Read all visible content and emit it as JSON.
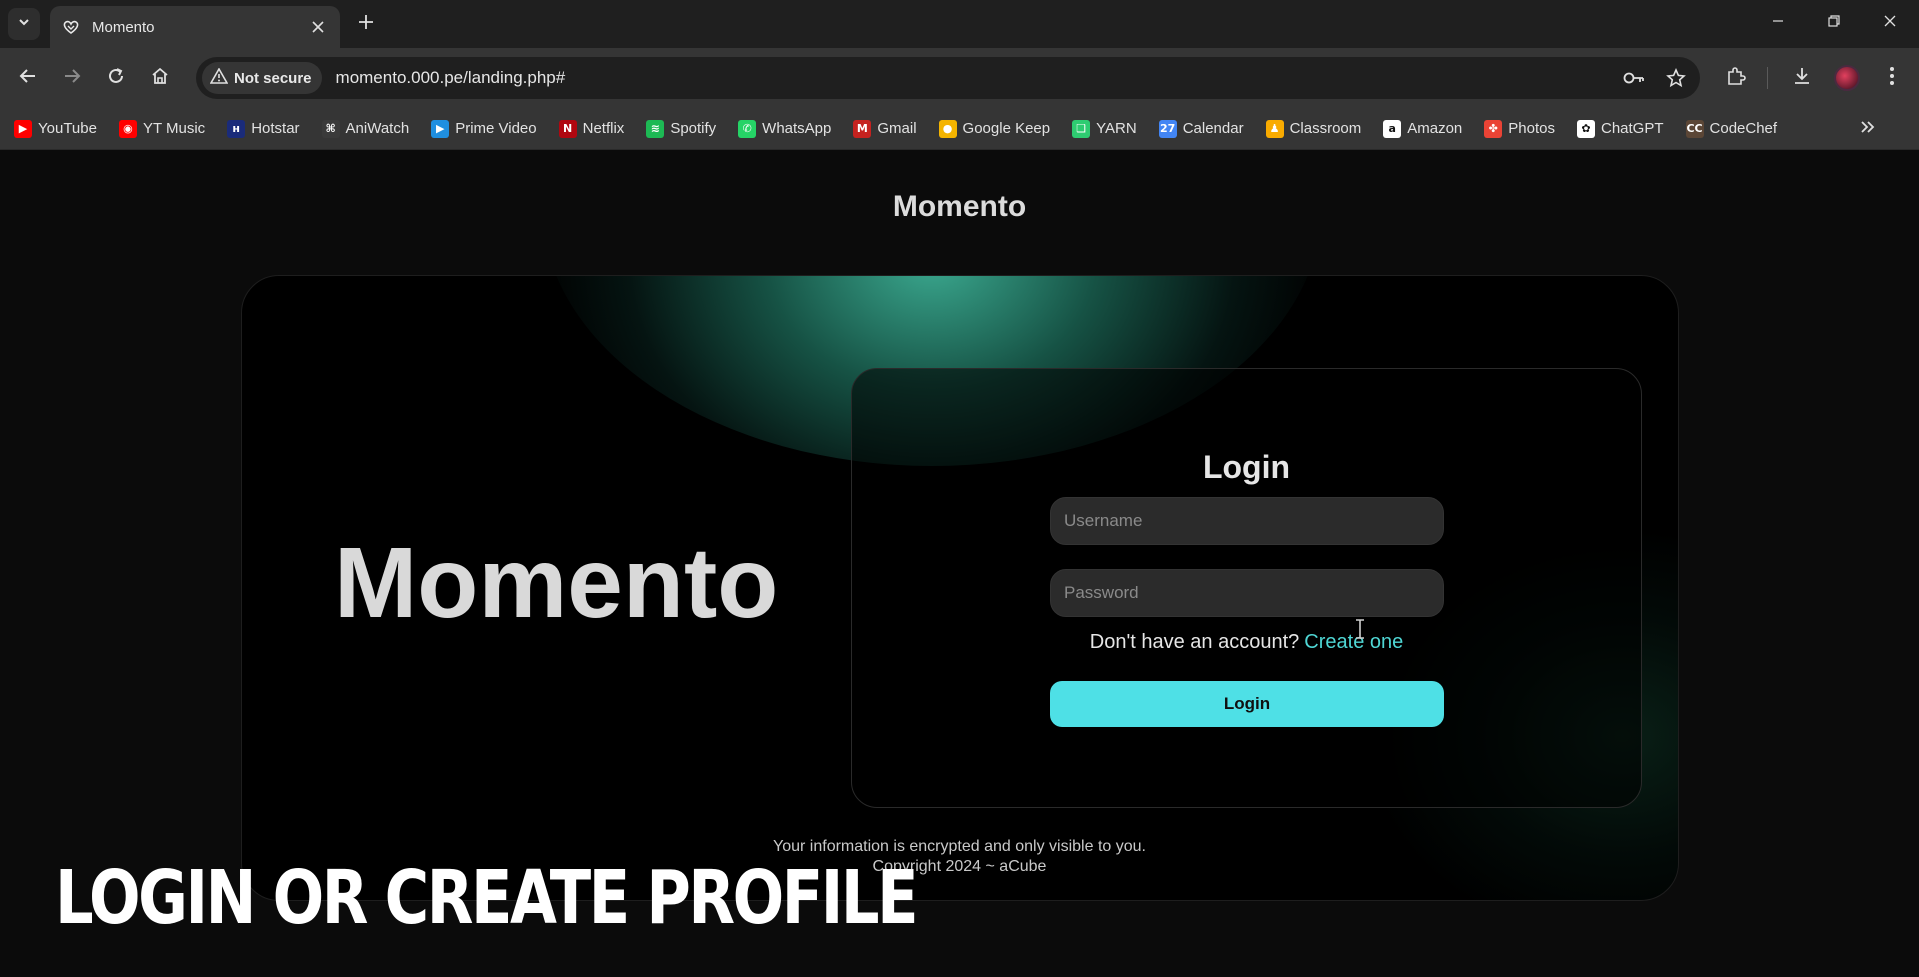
{
  "browser": {
    "tab": {
      "title": "Momento",
      "active": true
    },
    "security_label": "Not secure",
    "url": "momento.000.pe/landing.php#"
  },
  "bookmarks": [
    {
      "label": "YouTube",
      "icon": "youtube-icon",
      "color": "#ff0000",
      "glyph": "▶"
    },
    {
      "label": "YT Music",
      "icon": "yt-music-icon",
      "color": "#ff0000",
      "glyph": "◉"
    },
    {
      "label": "Hotstar",
      "icon": "hotstar-icon",
      "color": "#1a2b7a",
      "glyph": "ʜ"
    },
    {
      "label": "AniWatch",
      "icon": "aniwatch-icon",
      "color": "#3a3a3a",
      "glyph": "⌘"
    },
    {
      "label": "Prime Video",
      "icon": "prime-video-icon",
      "color": "#1f8fe0",
      "glyph": "▶"
    },
    {
      "label": "Netflix",
      "icon": "netflix-icon",
      "color": "#b00710",
      "glyph": "N"
    },
    {
      "label": "Spotify",
      "icon": "spotify-icon",
      "color": "#1db954",
      "glyph": "≋"
    },
    {
      "label": "WhatsApp",
      "icon": "whatsapp-icon",
      "color": "#25d366",
      "glyph": "✆"
    },
    {
      "label": "Gmail",
      "icon": "gmail-icon",
      "color": "#c5221f",
      "glyph": "M"
    },
    {
      "label": "Google Keep",
      "icon": "google-keep-icon",
      "color": "#f4b400",
      "glyph": "●"
    },
    {
      "label": "YARN",
      "icon": "yarn-icon",
      "color": "#2ecc71",
      "glyph": "❑"
    },
    {
      "label": "Calendar",
      "icon": "calendar-icon",
      "color": "#4285f4",
      "glyph": "27"
    },
    {
      "label": "Classroom",
      "icon": "classroom-icon",
      "color": "#f9ab00",
      "glyph": "♟"
    },
    {
      "label": "Amazon",
      "icon": "amazon-icon",
      "color": "#ffffff",
      "glyph": "a"
    },
    {
      "label": "Photos",
      "icon": "photos-icon",
      "color": "#ea4335",
      "glyph": "✤"
    },
    {
      "label": "ChatGPT",
      "icon": "chatgpt-icon",
      "color": "#ffffff",
      "glyph": "✿"
    },
    {
      "label": "CodeChef",
      "icon": "codechef-icon",
      "color": "#5b4636",
      "glyph": "CC"
    }
  ],
  "page": {
    "title": "Momento",
    "hero_brand": "Momento",
    "login": {
      "heading": "Login",
      "username_placeholder": "Username",
      "password_placeholder": "Password",
      "signup_prompt": "Don't have an account?",
      "signup_link": "Create one",
      "button_label": "Login"
    },
    "footer": {
      "line1": "Your information is encrypted and only visible to you.",
      "line2": "Copyright 2024 ~ aCube"
    }
  },
  "overlay_caption": "LOGIN OR CREATE PROFILE",
  "colors": {
    "accent": "#4ee0e6",
    "link": "#4fd6d4",
    "glow": "#46c8aa"
  }
}
